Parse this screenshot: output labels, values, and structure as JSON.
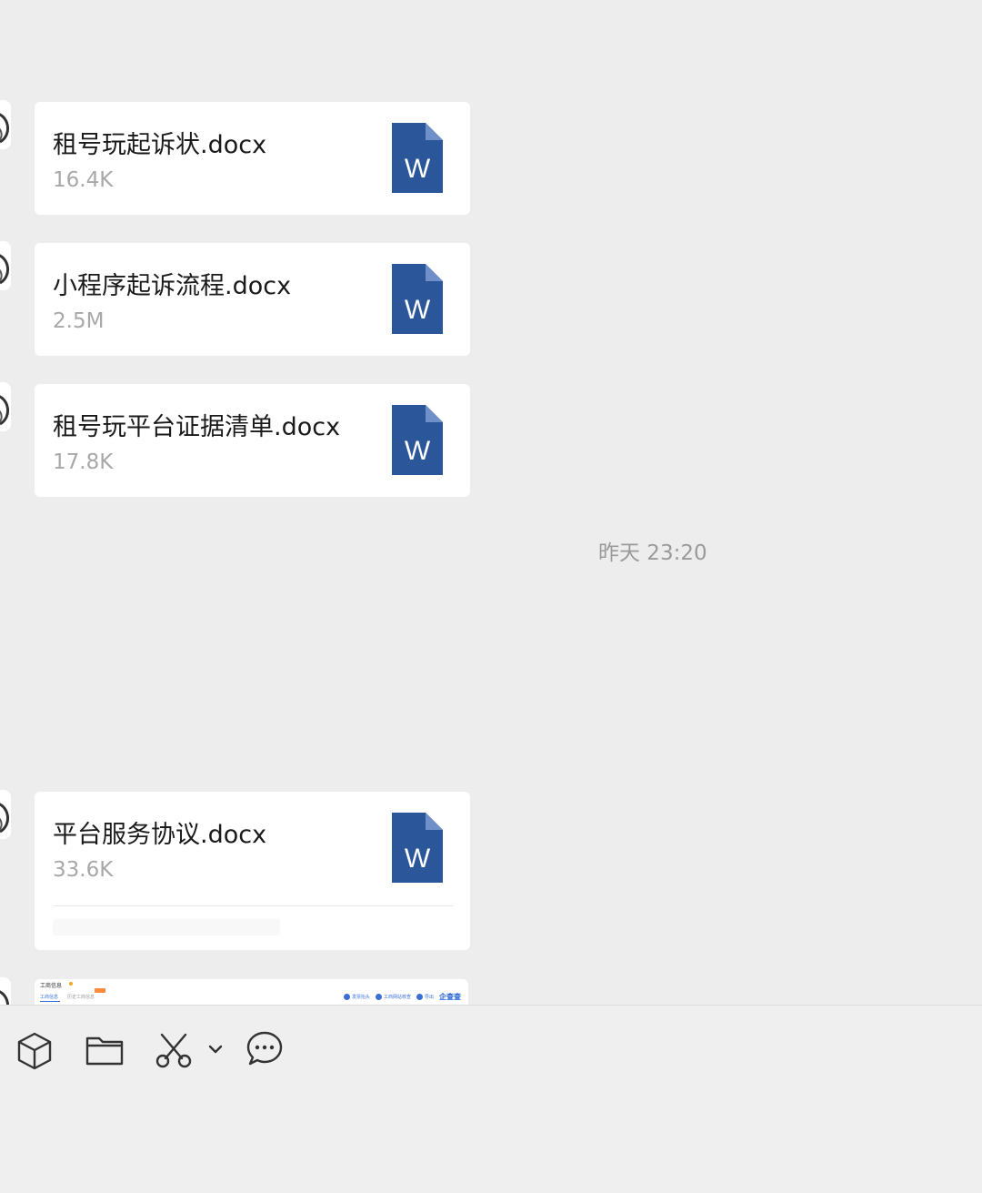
{
  "messages": [
    {
      "file_name": "租号玩起诉状.docx",
      "file_size": "16.4K",
      "file_type": "word-doc"
    },
    {
      "file_name": "小程序起诉流程.docx",
      "file_size": "2.5M",
      "file_type": "word-doc"
    },
    {
      "file_name": "租号玩平台证据清单.docx",
      "file_size": "17.8K",
      "file_type": "word-doc"
    },
    {
      "file_name": "平台服务协议.docx",
      "file_size": "33.6K",
      "file_type": "word-doc"
    }
  ],
  "timestamp": "昨天 23:20",
  "word_icon_letter": "W",
  "preview": {
    "title": "工商信息",
    "tab_active": "工商信息",
    "tab_other": "历史工商信息",
    "tool_1": "发票抬头",
    "tool_2": "工商网站核查",
    "tool_3": "导出",
    "brand": "企查查"
  },
  "toolbar": {
    "icons": [
      "box-3d-icon",
      "folder-icon",
      "scissors-icon",
      "chevron-down-icon",
      "chat-bubble-icon"
    ]
  },
  "colors": {
    "background": "#ededed",
    "card": "#ffffff",
    "word_blue": "#2b579a",
    "word_fold": "#6f8fc9",
    "secondary_text": "#a8a8a8"
  }
}
